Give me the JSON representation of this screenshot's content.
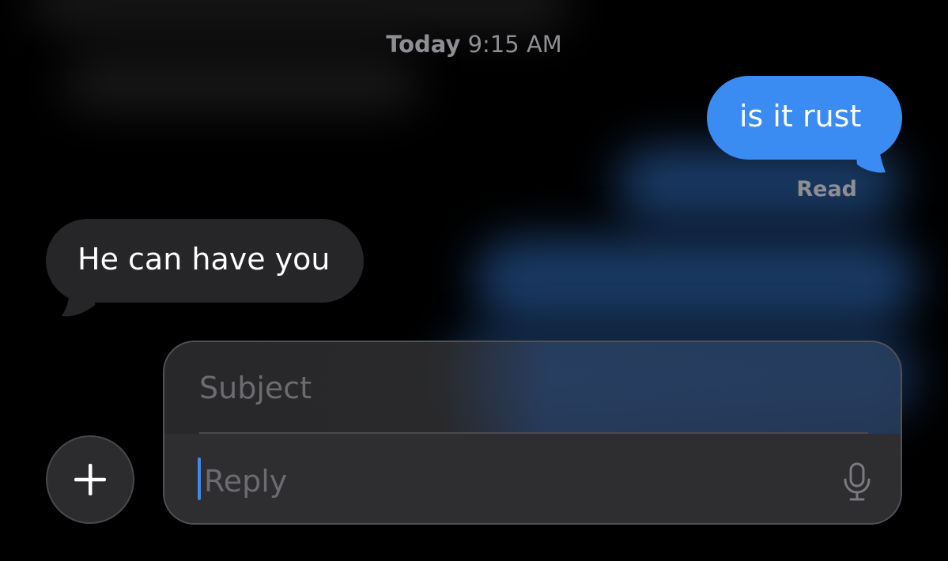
{
  "timestamp": {
    "day": "Today",
    "time": "9:15 AM"
  },
  "messages": {
    "outgoing": {
      "text": "is it rust",
      "status": "Read",
      "color": "#3a8bf2"
    },
    "incoming": {
      "text": "He can have you",
      "color": "#262628"
    }
  },
  "composer": {
    "subject_placeholder": "Subject",
    "reply_placeholder": "Reply",
    "caret_color": "#3a8bf2"
  },
  "icons": {
    "add": "plus-icon",
    "dictation": "microphone-icon"
  }
}
